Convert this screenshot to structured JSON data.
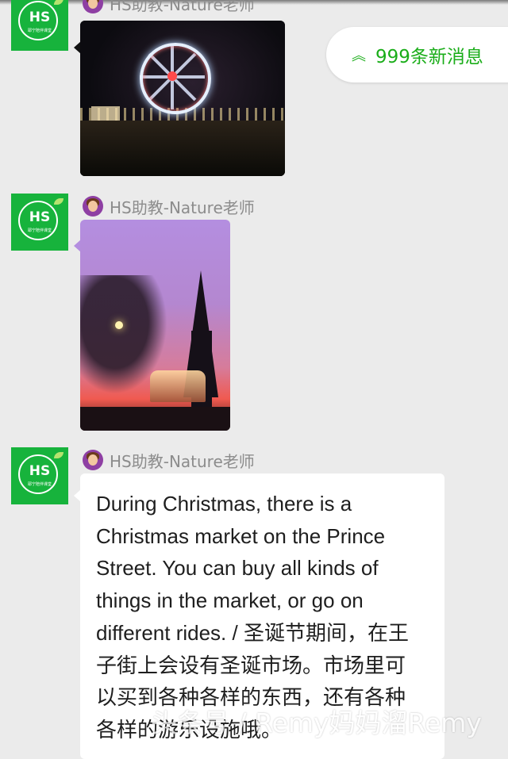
{
  "new_message_pill": {
    "icon": "double-chevron-up-icon",
    "label": "999条新消息",
    "color": "#1aad19"
  },
  "avatar_brand": {
    "text": "HS",
    "subtext": "耶宁陪伴课堂",
    "color": "#17b33c"
  },
  "messages": [
    {
      "sender": "HS助教-Nature老师",
      "type": "image",
      "image": "ferris-wheel-night-photo"
    },
    {
      "sender": "HS助教-Nature老师",
      "type": "image",
      "image": "monument-sunset-photo"
    },
    {
      "sender": "HS助教-Nature老师",
      "type": "text",
      "text_lines": [
        "During Christmas, there is a",
        "Christmas market on the Prince",
        "Street. You can buy all kinds of",
        "things in the market, or go on",
        "different rides. / 圣诞节期间，在王",
        "子街上会设有圣诞市场。市场里可",
        "以买到各种各样的东西，还有各种",
        "各样的游乐设施哦。"
      ]
    }
  ],
  "watermark": "头条号 / Remy妈妈溜Remy"
}
